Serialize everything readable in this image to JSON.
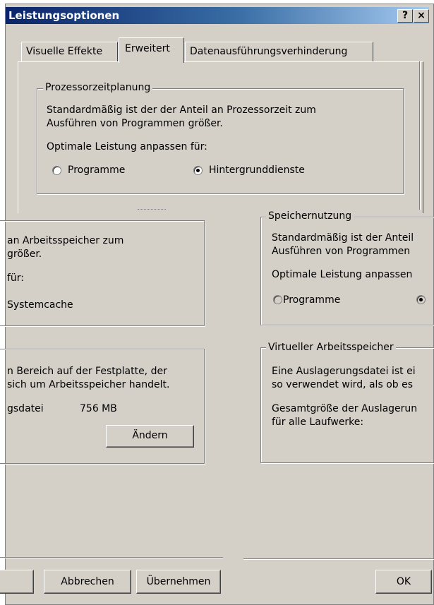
{
  "window": {
    "title": "Leistungsoptionen",
    "help_button": "?",
    "close_button": "×"
  },
  "tabs": [
    {
      "label": "Visuelle Effekte"
    },
    {
      "label": "Erweitert"
    },
    {
      "label": "Datenausführungsverhinderung"
    }
  ],
  "processor": {
    "legend": "Prozessorzeitplanung",
    "line1": "Standardmäßig ist der der Anteil an Prozessorzeit zum",
    "line2": "Ausführen von Programmen größer.",
    "adjust": "Optimale Leistung anpassen für:",
    "option_programs": "Programme",
    "option_background": "Hintergrunddienste"
  },
  "left_memory": {
    "line1": "an Arbeitsspeicher zum",
    "line2": "größer.",
    "line3": "für:",
    "option": "Systemcache"
  },
  "left_virtual": {
    "line1": "n Bereich auf der Festplatte, der",
    "line2": "sich um Arbeitsspeicher handelt.",
    "label": "gsdatei",
    "size": "756 MB",
    "change_button": "Ändern"
  },
  "memory": {
    "legend": "Speichernutzung",
    "line1": "Standardmäßig ist der Anteil",
    "line2": "Ausführen von Programmen",
    "adjust": "Optimale Leistung anpassen",
    "option_programs": "Programme"
  },
  "virtual": {
    "legend": "Virtueller Arbeitsspeicher",
    "line1": "Eine Auslagerungsdatei ist ei",
    "line2": "so verwendet wird, als ob es",
    "line3": "Gesamtgröße der Auslagerun",
    "line4": "für alle Laufwerke:"
  },
  "buttons": {
    "cancel": "Abbrechen",
    "apply": "Übernehmen",
    "ok": "OK"
  }
}
